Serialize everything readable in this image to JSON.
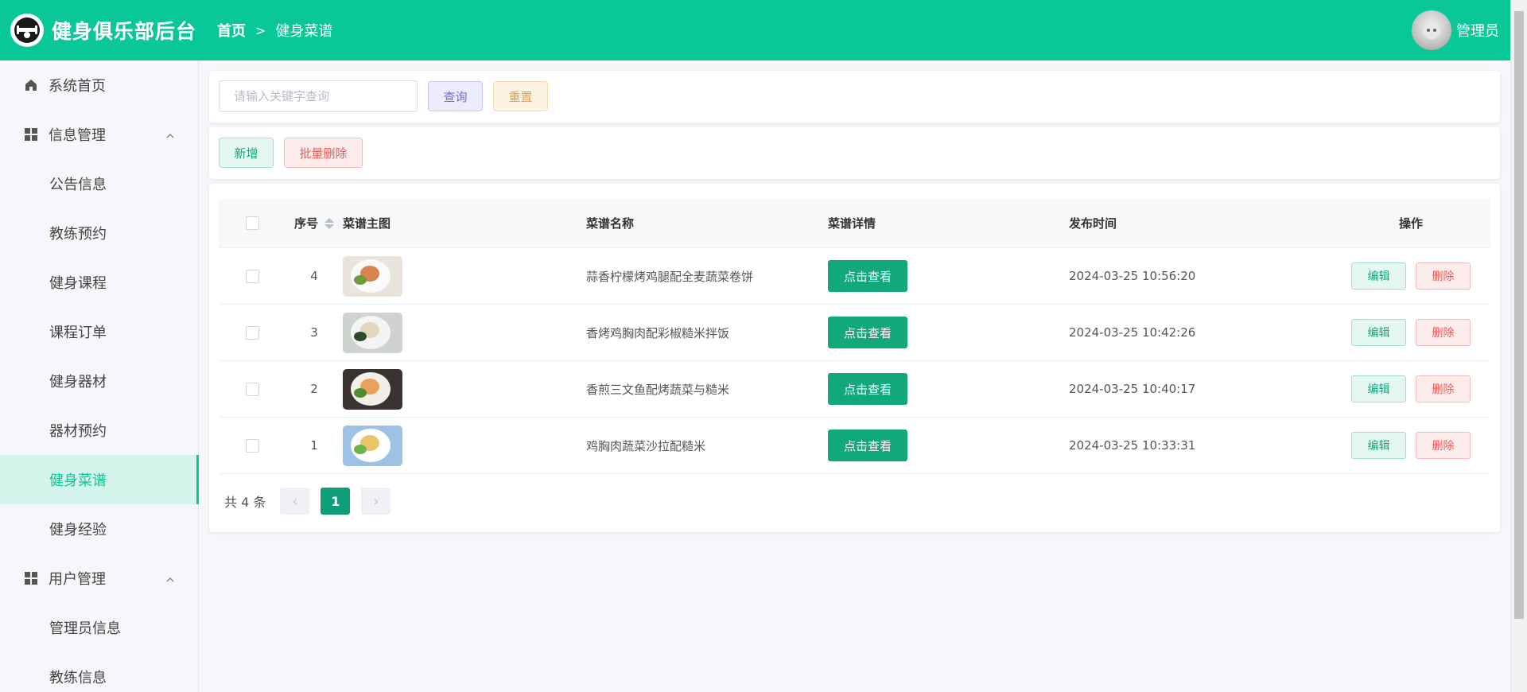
{
  "header": {
    "app_title": "健身俱乐部后台",
    "breadcrumb_home": "首页",
    "breadcrumb_current": "健身菜谱",
    "user_name": "管理员",
    "brand_color": "#0ac797"
  },
  "sidebar": {
    "items": [
      {
        "label": "系统首页",
        "type": "top",
        "icon": "home-icon"
      },
      {
        "label": "信息管理",
        "type": "group",
        "icon": "grid-icon"
      },
      {
        "label": "公告信息",
        "type": "sub"
      },
      {
        "label": "教练预约",
        "type": "sub"
      },
      {
        "label": "健身课程",
        "type": "sub"
      },
      {
        "label": "课程订单",
        "type": "sub"
      },
      {
        "label": "健身器材",
        "type": "sub"
      },
      {
        "label": "器材预约",
        "type": "sub"
      },
      {
        "label": "健身菜谱",
        "type": "sub",
        "active": true
      },
      {
        "label": "健身经验",
        "type": "sub"
      },
      {
        "label": "用户管理",
        "type": "group",
        "icon": "grid-icon"
      },
      {
        "label": "管理员信息",
        "type": "sub"
      },
      {
        "label": "教练信息",
        "type": "sub"
      }
    ]
  },
  "search": {
    "placeholder": "请输入关键字查询",
    "value": "",
    "query_label": "查询",
    "reset_label": "重置"
  },
  "toolbar": {
    "add_label": "新增",
    "batch_delete_label": "批量删除"
  },
  "table": {
    "headers": {
      "no": "序号",
      "image": "菜谱主图",
      "name": "菜谱名称",
      "detail": "菜谱详情",
      "time": "发布时间",
      "ops": "操作"
    },
    "rows": [
      {
        "no": "4",
        "name": "蒜香柠檬烤鸡腿配全麦蔬菜卷饼",
        "detail_label": "点击查看",
        "time": "2024-03-25 10:56:20",
        "edit_label": "编辑",
        "delete_label": "删除"
      },
      {
        "no": "3",
        "name": "香烤鸡胸肉配彩椒糙米拌饭",
        "detail_label": "点击查看",
        "time": "2024-03-25 10:42:26",
        "edit_label": "编辑",
        "delete_label": "删除"
      },
      {
        "no": "2",
        "name": "香煎三文鱼配烤蔬菜与糙米",
        "detail_label": "点击查看",
        "time": "2024-03-25 10:40:17",
        "edit_label": "编辑",
        "delete_label": "删除"
      },
      {
        "no": "1",
        "name": "鸡胸肉蔬菜沙拉配糙米",
        "detail_label": "点击查看",
        "time": "2024-03-25 10:33:31",
        "edit_label": "编辑",
        "delete_label": "删除"
      }
    ]
  },
  "pagination": {
    "total": "共 4 条",
    "current_page": "1"
  }
}
